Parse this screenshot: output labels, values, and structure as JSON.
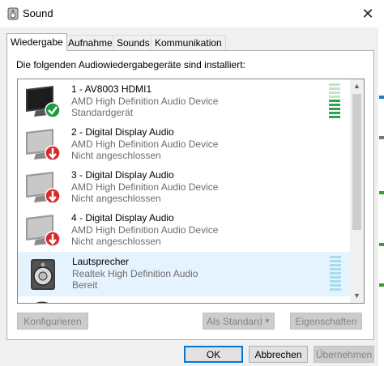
{
  "window": {
    "title": "Sound",
    "close_label": "✕"
  },
  "tabs": [
    {
      "label": "Wiedergabe",
      "active": true
    },
    {
      "label": "Aufnahme",
      "active": false
    },
    {
      "label": "Sounds",
      "active": false
    },
    {
      "label": "Kommunikation",
      "active": false
    }
  ],
  "panel": {
    "intro": "Die folgenden Audiowiedergabegeräte sind installiert:"
  },
  "devices": [
    {
      "name": "1 - AV8003 HDMI1",
      "driver": "AMD High Definition Audio Device",
      "status": "Standardgerät",
      "icon": "monitor-icon",
      "badge": "green-check-icon",
      "level_color": "#2ea44f"
    },
    {
      "name": "2 - Digital Display Audio",
      "driver": "AMD High Definition Audio Device",
      "status": "Nicht angeschlossen",
      "icon": "monitor-icon",
      "badge": "red-down-arrow-icon"
    },
    {
      "name": "3 - Digital Display Audio",
      "driver": "AMD High Definition Audio Device",
      "status": "Nicht angeschlossen",
      "icon": "monitor-icon",
      "badge": "red-down-arrow-icon"
    },
    {
      "name": "4 - Digital Display Audio",
      "driver": "AMD High Definition Audio Device",
      "status": "Nicht angeschlossen",
      "icon": "monitor-icon",
      "badge": "red-down-arrow-icon"
    },
    {
      "name": "Lautsprecher",
      "driver": "Realtek High Definition Audio",
      "status": "Bereit",
      "icon": "speaker-icon",
      "selected": true,
      "level_color": "#a9dbe8"
    }
  ],
  "buttons": {
    "configure": "Konfigurieren",
    "set_default": "Als Standard",
    "properties": "Eigenschaften",
    "ok": "OK",
    "cancel": "Abbrechen",
    "apply": "Übernehmen"
  },
  "scroll": {
    "up": "▲",
    "down": "▼"
  },
  "colors": {
    "accent": "#0078d7",
    "selection": "#e5f3ff"
  }
}
